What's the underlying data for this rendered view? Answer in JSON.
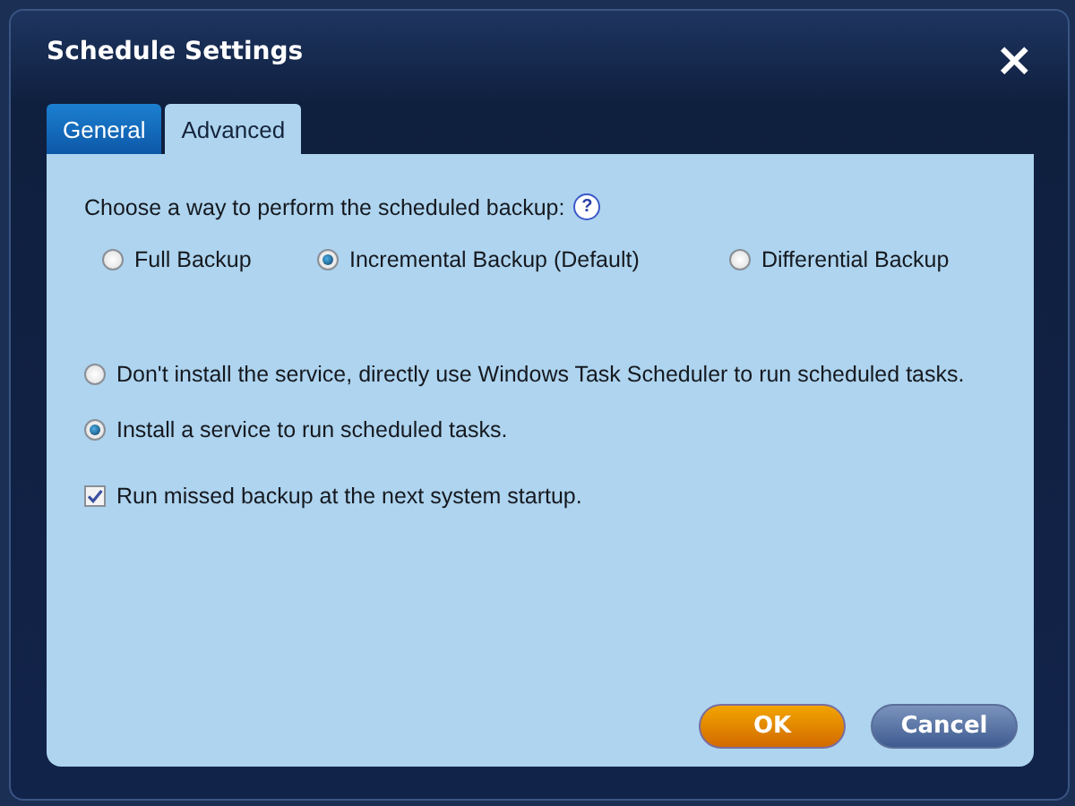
{
  "window": {
    "title": "Schedule Settings",
    "close": "×"
  },
  "tabs": [
    {
      "label": "General",
      "selected": false
    },
    {
      "label": "Advanced",
      "selected": true
    }
  ],
  "backup_method": {
    "prompt": "Choose a way to perform the scheduled backup:",
    "help": "?",
    "options": [
      {
        "label": "Full Backup",
        "selected": false
      },
      {
        "label": "Incremental Backup (Default)",
        "selected": true
      },
      {
        "label": "Differential Backup",
        "selected": false
      }
    ]
  },
  "service": {
    "options": [
      {
        "label": "Don't install the service, directly use Windows Task Scheduler to run scheduled tasks.",
        "selected": false
      },
      {
        "label": "Install a service to run scheduled tasks.",
        "selected": true
      }
    ]
  },
  "run_missed": {
    "label": "Run missed backup at the next system startup.",
    "checked": true
  },
  "buttons": [
    {
      "label": "OK",
      "kind": "primary"
    },
    {
      "label": "Cancel",
      "kind": "secondary"
    }
  ]
}
